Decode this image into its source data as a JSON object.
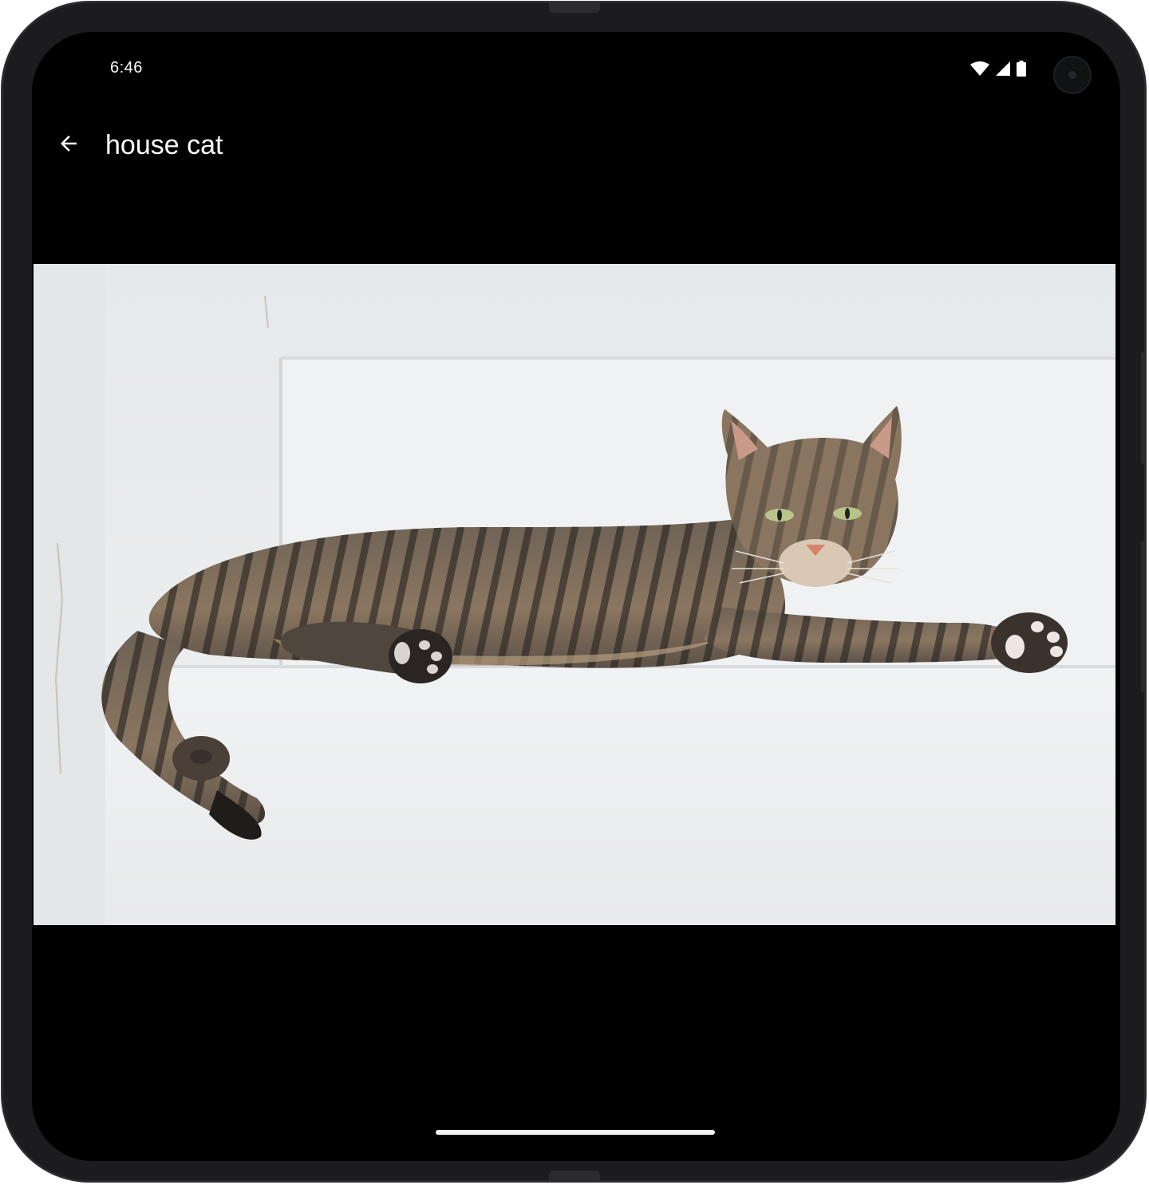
{
  "status_bar": {
    "time": "6:46",
    "icons": [
      "wifi-icon",
      "cellular-signal-icon",
      "battery-icon"
    ]
  },
  "app_bar": {
    "back_icon": "arrow-back-icon",
    "title": "house cat"
  },
  "photo": {
    "subject": "tabby-cat-photo"
  },
  "colors": {
    "background": "#000000",
    "text": "#ffffff",
    "device_frame": "#1c1c1e"
  }
}
